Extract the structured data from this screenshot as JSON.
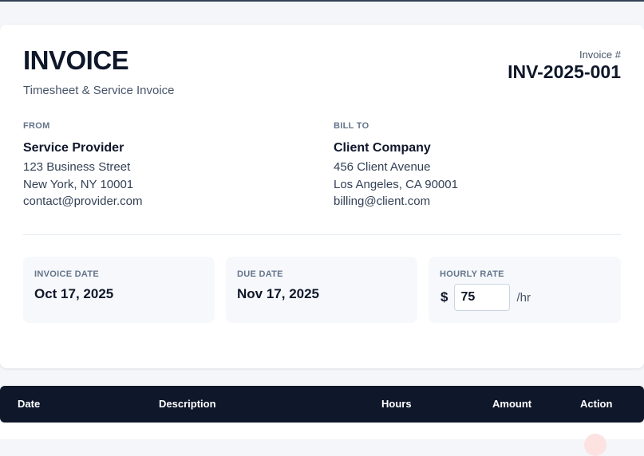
{
  "invoice": {
    "title": "INVOICE",
    "subtitle": "Timesheet & Service Invoice",
    "number_label": "Invoice #",
    "number": "INV-2025-001"
  },
  "from": {
    "label": "FROM",
    "name": "Service Provider",
    "address1": "123 Business Street",
    "address2": "New York, NY 10001",
    "email": "contact@provider.com"
  },
  "bill_to": {
    "label": "BILL TO",
    "name": "Client Company",
    "address1": "456 Client Avenue",
    "address2": "Los Angeles, CA 90001",
    "email": "billing@client.com"
  },
  "details": {
    "invoice_date_label": "INVOICE DATE",
    "invoice_date": "Oct 17, 2025",
    "due_date_label": "DUE DATE",
    "due_date": "Nov 17, 2025",
    "hourly_rate_label": "HOURLY RATE",
    "currency_symbol": "$",
    "hourly_rate": "75",
    "rate_unit": "/hr"
  },
  "table": {
    "columns": [
      "Date",
      "Description",
      "Hours",
      "Amount",
      "Action"
    ]
  },
  "colors": {
    "header_bg": "#0f172a",
    "card_bg": "#ffffff",
    "page_bg": "#f4f6f9",
    "muted_text": "#64748b"
  }
}
